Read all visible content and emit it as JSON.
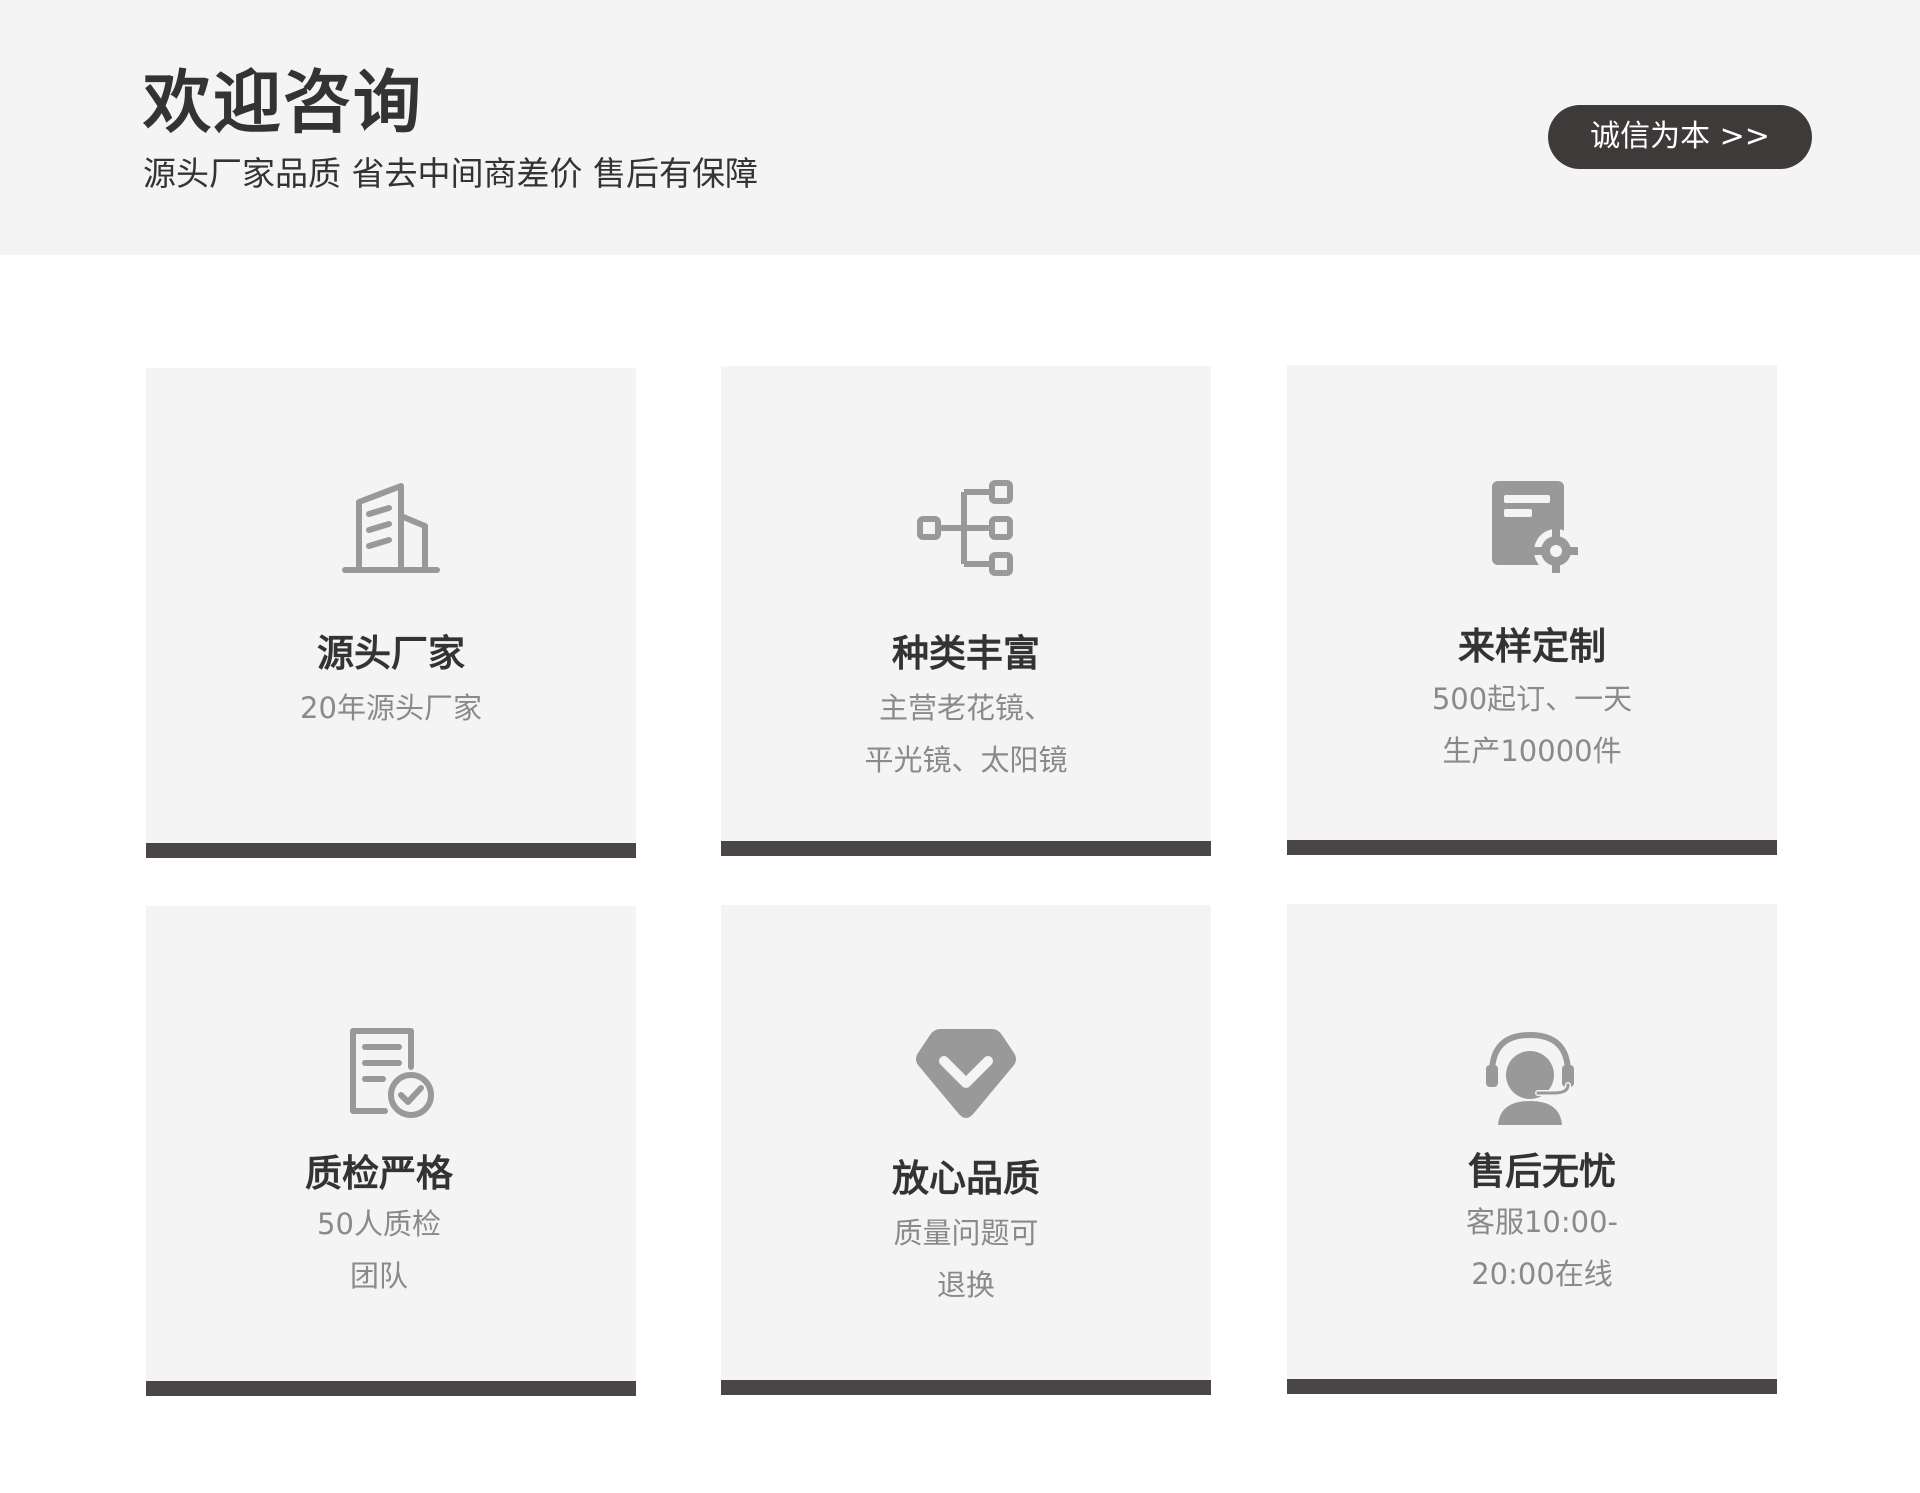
{
  "header": {
    "title": "欢迎咨询",
    "subtitle": "源头厂家品质 省去中间商差价 售后有保障",
    "cta_label": "诚信为本 >>"
  },
  "colors": {
    "header_bg": "#f3f4f3",
    "card_bg": "#f3f4f3",
    "accent_dark": "#3e3a39",
    "icon_gray": "#999999",
    "desc_gray": "#8a8a8a"
  },
  "cards": [
    {
      "icon": "building-icon",
      "title": "源头厂家",
      "desc": [
        "20年源头厂家"
      ]
    },
    {
      "icon": "hierarchy-icon",
      "title": "种类丰富",
      "desc": [
        "主营老花镜、",
        "平光镜、太阳镜"
      ]
    },
    {
      "icon": "custom-document-icon",
      "title": "来样定制",
      "desc": [
        "500起订、一天",
        "生产10000件"
      ]
    },
    {
      "icon": "checked-document-icon",
      "title": "质检严格",
      "desc": [
        "50人质检",
        "团队"
      ]
    },
    {
      "icon": "shield-check-icon",
      "title": "放心品质",
      "desc": [
        "质量问题可",
        "退换"
      ]
    },
    {
      "icon": "customer-service-icon",
      "title": "售后无忧",
      "desc": [
        "客服10:00-",
        "20:00在线"
      ]
    }
  ]
}
